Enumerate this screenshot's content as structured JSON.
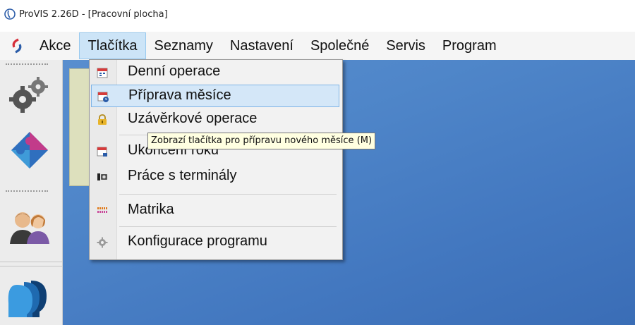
{
  "window": {
    "title": "ProVIS 2.26D - [Pracovní plocha]"
  },
  "menubar": {
    "items": [
      {
        "label": "Akce"
      },
      {
        "label": "Tlačítka"
      },
      {
        "label": "Seznamy"
      },
      {
        "label": "Nastavení"
      },
      {
        "label": "Společné"
      },
      {
        "label": "Servis"
      },
      {
        "label": "Program"
      }
    ],
    "active_item": "Tlačítka"
  },
  "dropdown": {
    "items": [
      {
        "label": "Denní operace",
        "icon": "calendar-day-icon"
      },
      {
        "label": "Příprava měsíce",
        "icon": "calendar-clock-icon"
      },
      {
        "label": "Uzávěrkové operace",
        "icon": "lock-icon"
      },
      {
        "label": "Ukončení roku",
        "icon": "calendar-year-icon"
      },
      {
        "label": "Práce s terminály",
        "icon": "terminal-icon"
      },
      {
        "label": "Matrika",
        "icon": "registry-icon"
      },
      {
        "label": "Konfigurace programu",
        "icon": "gear-icon"
      }
    ],
    "highlighted_item": "Příprava měsíce"
  },
  "tooltip": {
    "text": "Zobrazí tlačítka pro přípravu nového měsíce (M)"
  },
  "toolbar": {
    "icons": [
      "gears-icon",
      "puzzle-icon",
      "users-icon",
      "heads-icon"
    ]
  },
  "colors": {
    "desktop": "#4f86c9",
    "menu_highlight": "#cce4f7",
    "tooltip_bg": "#ffffe1",
    "panel": "#dde0bd"
  }
}
